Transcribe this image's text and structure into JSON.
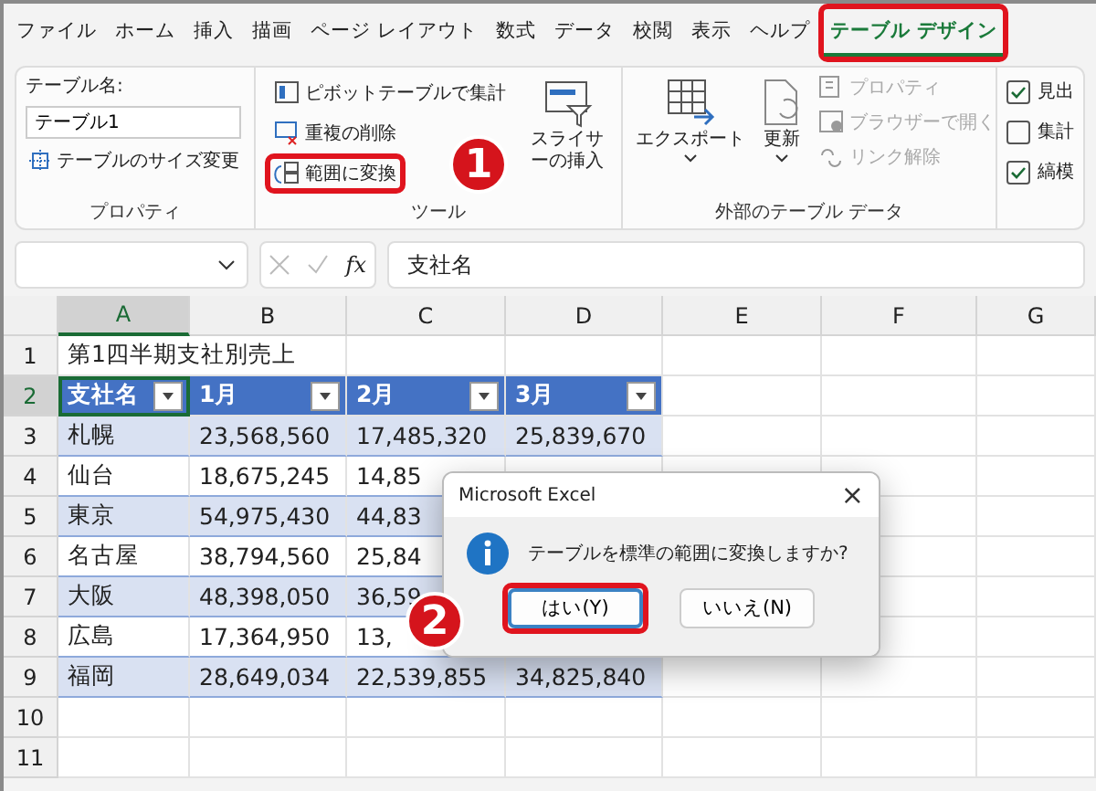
{
  "menu_tabs": [
    {
      "label": "ファイル",
      "selected": false,
      "highlighted": false
    },
    {
      "label": "ホーム",
      "selected": false,
      "highlighted": false
    },
    {
      "label": "挿入",
      "selected": false,
      "highlighted": false
    },
    {
      "label": "描画",
      "selected": false,
      "highlighted": false
    },
    {
      "label": "ページ レイアウト",
      "selected": false,
      "highlighted": false
    },
    {
      "label": "数式",
      "selected": false,
      "highlighted": false
    },
    {
      "label": "データ",
      "selected": false,
      "highlighted": false
    },
    {
      "label": "校閲",
      "selected": false,
      "highlighted": false
    },
    {
      "label": "表示",
      "selected": false,
      "highlighted": false
    },
    {
      "label": "ヘルプ",
      "selected": false,
      "highlighted": false
    },
    {
      "label": "テーブル デザイン",
      "selected": true,
      "highlighted": true
    }
  ],
  "ribbon": {
    "properties": {
      "name_label": "テーブル名:",
      "name_value": "テーブル1",
      "resize": "テーブルのサイズ変更",
      "group_label": "プロパティ"
    },
    "tools": {
      "items": [
        {
          "label": "ピボットテーブルで集計",
          "highlighted": false
        },
        {
          "label": "重複の削除",
          "highlighted": false
        },
        {
          "label": "範囲に変換",
          "highlighted": true
        }
      ],
      "slicer": "スライサーの挿入",
      "group_label": "ツール"
    },
    "external": {
      "export": "エクスポート",
      "refresh": "更新",
      "items": [
        {
          "label": "プロパティ",
          "disabled": true
        },
        {
          "label": "ブラウザーで開く",
          "disabled": true
        },
        {
          "label": "リンク解除",
          "disabled": true
        }
      ],
      "group_label": "外部のテーブル データ"
    },
    "options": [
      {
        "label": "見出",
        "checked": true
      },
      {
        "label": "集計",
        "checked": false
      },
      {
        "label": "縞模",
        "checked": true
      }
    ]
  },
  "formula_bar": {
    "function_label": "fx",
    "formula": "支社名"
  },
  "columns": [
    {
      "label": "A",
      "selected": true
    },
    {
      "label": "B",
      "selected": false
    },
    {
      "label": "C",
      "selected": false
    },
    {
      "label": "D",
      "selected": false
    },
    {
      "label": "E",
      "selected": false
    },
    {
      "label": "F",
      "selected": false
    },
    {
      "label": "G",
      "selected": false
    }
  ],
  "rows": [
    {
      "number": "1",
      "selected": false,
      "kind": "title",
      "cells": [
        "第1四半期支社別売上"
      ]
    },
    {
      "number": "2",
      "selected": true,
      "kind": "table_header",
      "cells": [
        "支社名",
        "1月",
        "2月",
        "3月"
      ]
    },
    {
      "number": "3",
      "selected": false,
      "kind": "table_band",
      "cells": [
        "札幌",
        "23,568,560",
        "17,485,320",
        "25,839,670"
      ]
    },
    {
      "number": "4",
      "selected": false,
      "kind": "table_row",
      "cells": [
        "仙台",
        "18,675,245",
        "14,85"
      ]
    },
    {
      "number": "5",
      "selected": false,
      "kind": "table_band",
      "cells": [
        "東京",
        "54,975,430",
        "44,83"
      ]
    },
    {
      "number": "6",
      "selected": false,
      "kind": "table_row",
      "cells": [
        "名古屋",
        "38,794,560",
        "25,84"
      ]
    },
    {
      "number": "7",
      "selected": false,
      "kind": "table_band",
      "cells": [
        "大阪",
        "48,398,050",
        "36,59"
      ]
    },
    {
      "number": "8",
      "selected": false,
      "kind": "table_row",
      "cells": [
        "広島",
        "17,364,950",
        "13,"
      ]
    },
    {
      "number": "9",
      "selected": false,
      "kind": "table_band",
      "cells": [
        "福岡",
        "28,649,034",
        "22,539,855",
        "34,825,840"
      ]
    },
    {
      "number": "10",
      "selected": false,
      "kind": "plain",
      "cells": []
    },
    {
      "number": "11",
      "selected": false,
      "kind": "plain",
      "cells": []
    }
  ],
  "dialog": {
    "title": "Microsoft Excel",
    "close": "×",
    "message": "テーブルを標準の範囲に変換しますか?",
    "buttons": [
      {
        "label": "はい(Y)",
        "selected": true,
        "highlighted": true
      },
      {
        "label": "いいえ(N)",
        "selected": false,
        "highlighted": false
      }
    ]
  },
  "callouts": [
    "1",
    "2"
  ]
}
